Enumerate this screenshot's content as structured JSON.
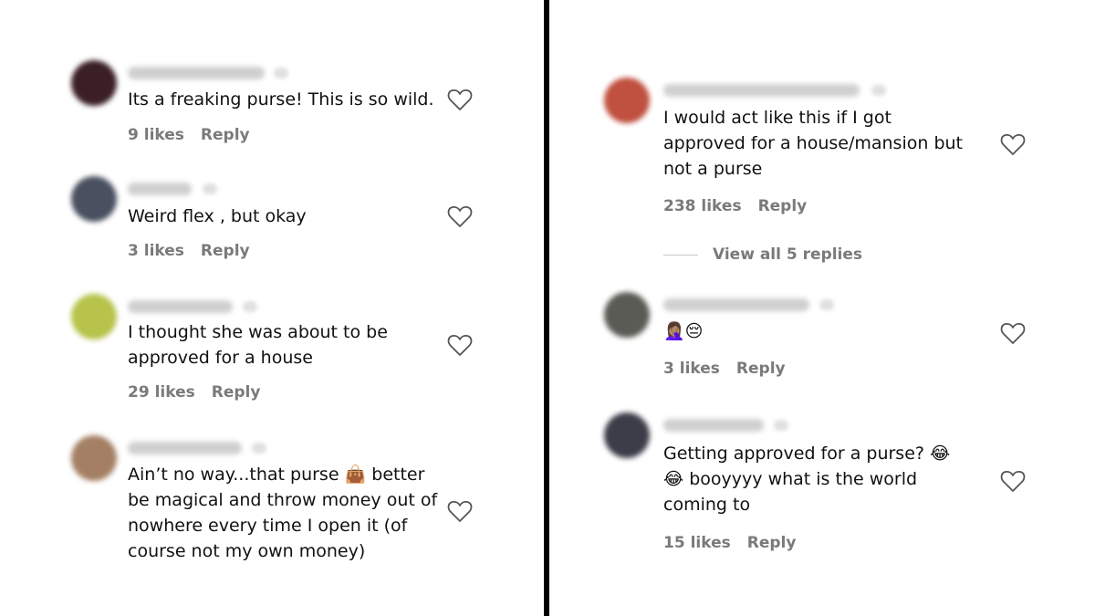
{
  "left_comments": [
    {
      "text": "Its a freaking purse! This is so wild.",
      "likes": "9 likes",
      "reply": "Reply",
      "avatar_color": "#3a1f24"
    },
    {
      "text": "Weird flex , but okay",
      "likes": "3 likes",
      "reply": "Reply",
      "avatar_color": "#4a5060"
    },
    {
      "text": "I thought she was about to be\napproved for a house",
      "likes": "29 likes",
      "reply": "Reply",
      "avatar_color": "#b7c34a"
    },
    {
      "text": "Ain’t no way...that purse 👜 better\nbe magical and throw money out of\nnowhere every time I open it (of\ncourse not my own money)",
      "likes": "",
      "reply": "",
      "avatar_color": "#a47f64"
    }
  ],
  "right_comments": [
    {
      "text": "I would act like this if I got\napproved for a house/mansion but\nnot a purse",
      "likes": "238 likes",
      "reply": "Reply",
      "avatar_color": "#c0503f"
    },
    {
      "text": "🤦🏽‍♀️😔",
      "likes": "3 likes",
      "reply": "Reply",
      "avatar_color": "#5b5b55"
    },
    {
      "text": "Getting approved for a purse? 😂\n😂 booyyyy what is the world\ncoming to",
      "likes": "15 likes",
      "reply": "Reply",
      "avatar_color": "#3d3d4a"
    }
  ],
  "view_replies": "View all 5 replies",
  "icons": {
    "like": "heart-outline-icon"
  },
  "colors": {
    "meta_text": "#7a7a7a",
    "body_text": "#111111",
    "divider": "#000000"
  }
}
